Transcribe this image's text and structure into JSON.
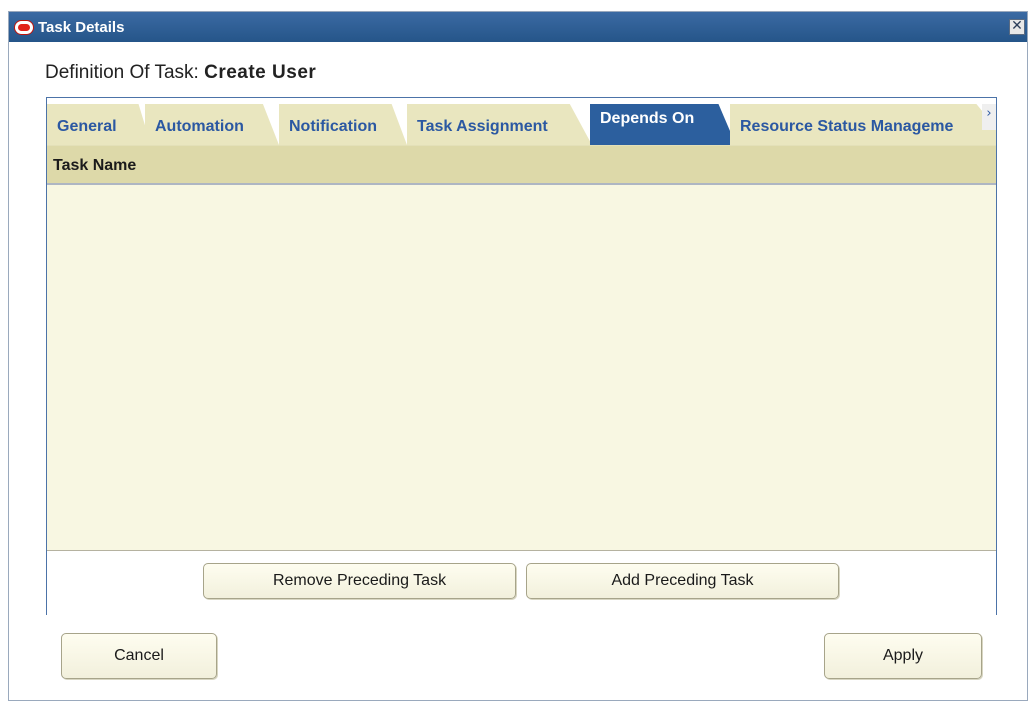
{
  "window": {
    "title": "Task Details",
    "close_glyph": "✕"
  },
  "definition": {
    "label": "Definition Of Task:",
    "value": "Create User"
  },
  "tabs": [
    {
      "label": "General",
      "active": false
    },
    {
      "label": "Automation",
      "active": false
    },
    {
      "label": "Notification",
      "active": false
    },
    {
      "label": "Task Assignment",
      "active": false
    },
    {
      "label": "Depends On",
      "active": true
    },
    {
      "label": "Resource Status Manageme",
      "active": false
    }
  ],
  "tab_scroll_glyph": "›",
  "table": {
    "columns": [
      "Task Name"
    ],
    "rows": []
  },
  "panel_buttons": {
    "remove": "Remove Preceding Task",
    "add": "Add Preceding Task"
  },
  "dialog_buttons": {
    "cancel": "Cancel",
    "apply": "Apply"
  },
  "colors": {
    "titlebar": "#2c5d96",
    "active_tab": "#2c5f9e",
    "inactive_tab": "#e9e6bf",
    "tab_text": "#2b58a2",
    "header_bg": "#ddd9a9",
    "body_bg": "#f8f7e2"
  },
  "icons": {
    "logo": "oracle-logo-icon",
    "close": "close-icon",
    "scroll": "chevron-right-icon"
  }
}
